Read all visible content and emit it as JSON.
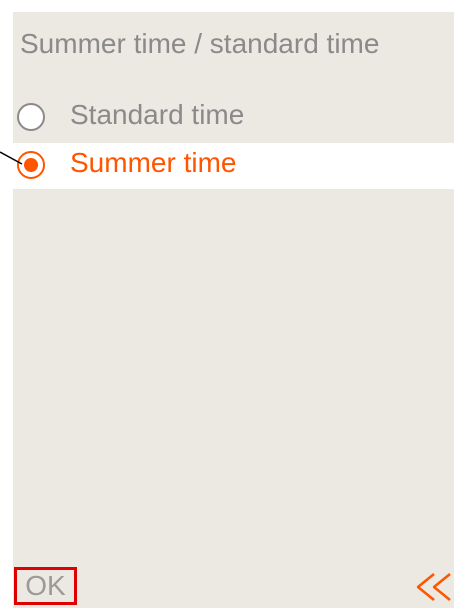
{
  "screen": {
    "title": "Summer time / standard time",
    "options": [
      {
        "label": "Standard time",
        "selected": false
      },
      {
        "label": "Summer time",
        "selected": true
      }
    ],
    "ok_label": "OK",
    "back_icon": "double-chevron-left-icon",
    "accent_color": "#ff5500",
    "highlight_border_color": "#e00000"
  }
}
